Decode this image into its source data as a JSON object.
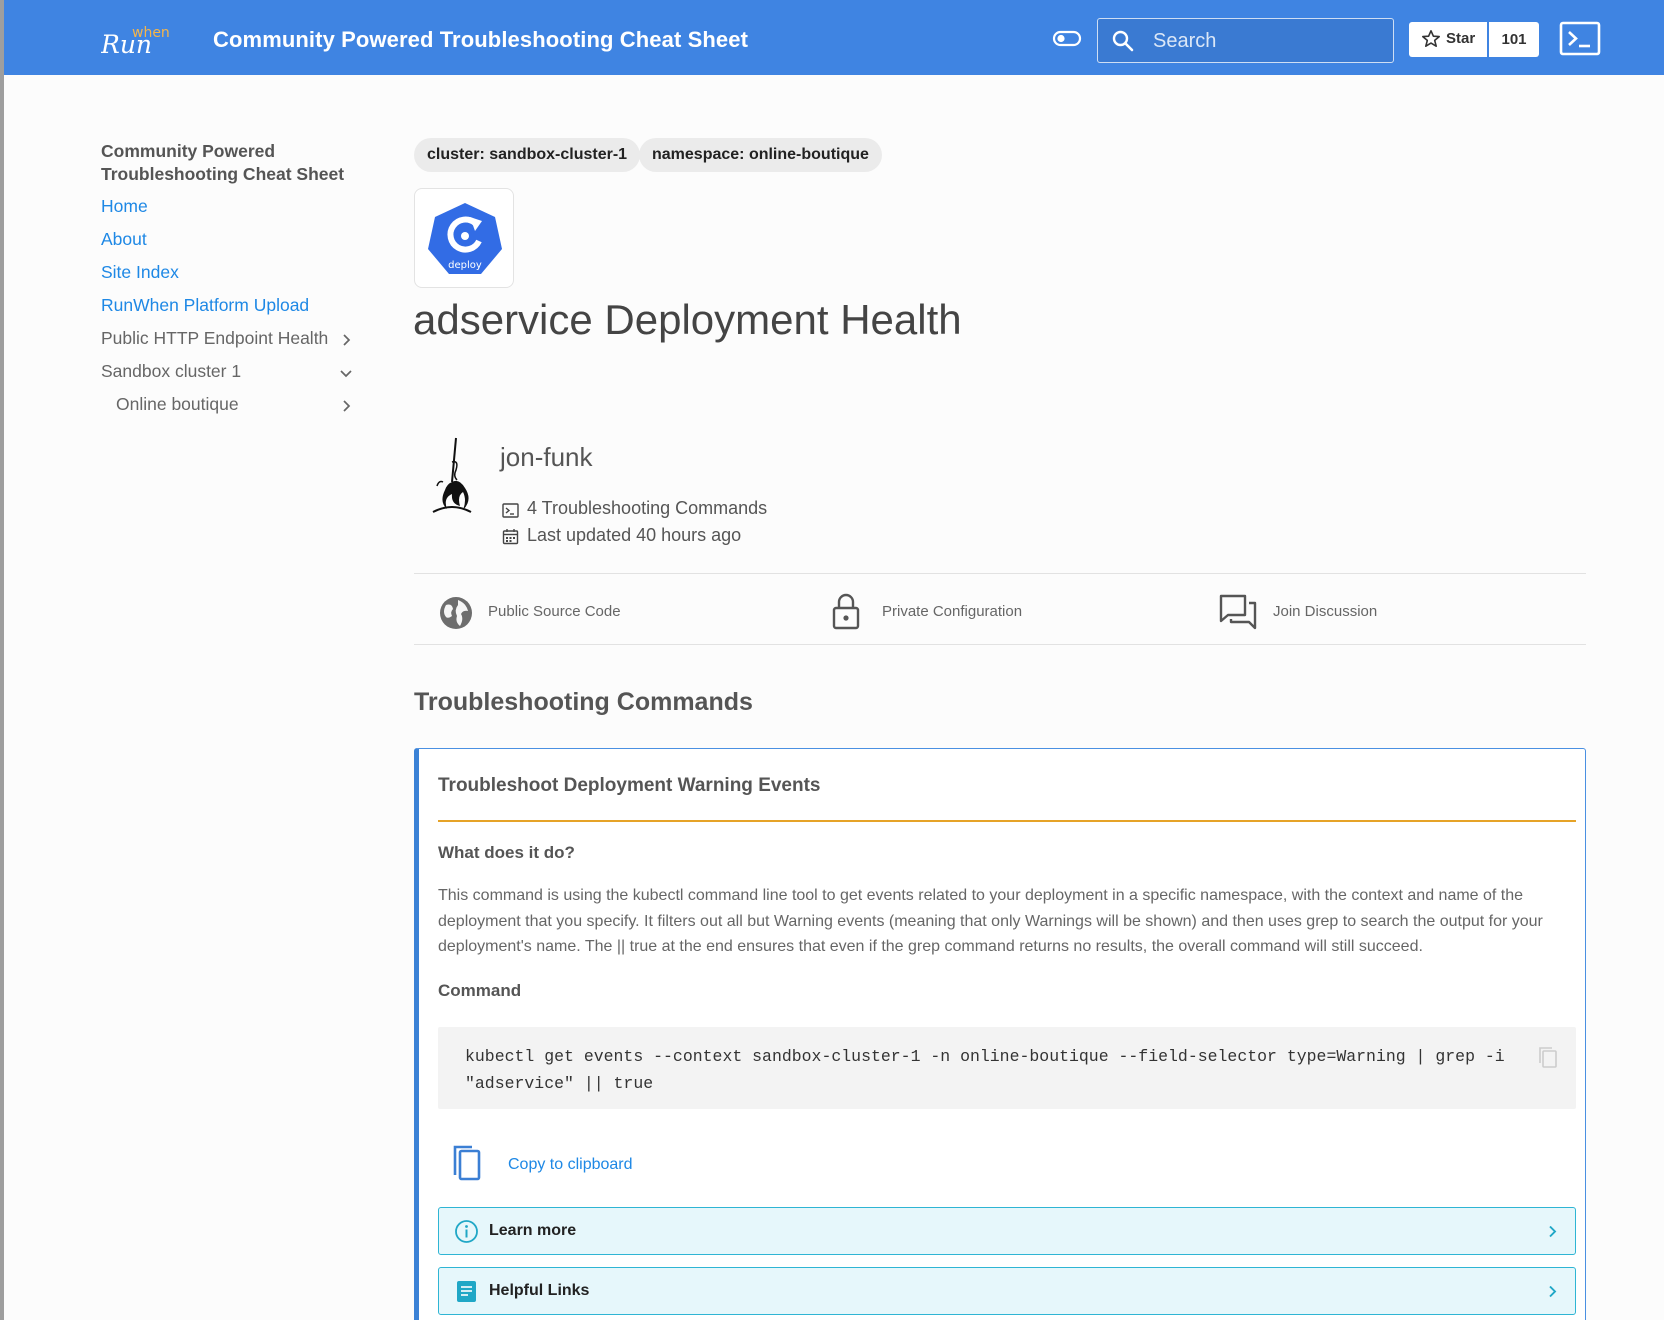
{
  "header": {
    "logo_text": "Run when",
    "title": "Community Powered Troubleshooting Cheat Sheet",
    "search_placeholder": "Search",
    "star_label": "Star",
    "star_count": "101",
    "accent_color": "#3f84e2"
  },
  "sidebar": {
    "title": "Community Powered Troubleshooting Cheat Sheet",
    "items": [
      {
        "label": "Home"
      },
      {
        "label": "About"
      },
      {
        "label": "Site Index"
      },
      {
        "label": "RunWhen Platform Upload"
      },
      {
        "label": "Public HTTP Endpoint Health",
        "icon": "chevron-right-icon"
      },
      {
        "label": "Sandbox cluster 1",
        "icon": "chevron-down-icon"
      },
      {
        "label": "Online boutique",
        "icon": "chevron-right-icon"
      }
    ]
  },
  "main": {
    "tags": [
      "cluster: sandbox-cluster-1",
      "namespace: online-boutique"
    ],
    "icon_label": "deploy",
    "page_title": "adservice Deployment Health",
    "author": "jon-funk",
    "commands_count": "4 Troubleshooting Commands",
    "last_updated": "Last updated 40 hours ago",
    "links": [
      {
        "label": "Public Source Code",
        "icon": "globe-icon"
      },
      {
        "label": "Private Configuration",
        "icon": "lock-icon"
      },
      {
        "label": "Join Discussion",
        "icon": "forum-icon"
      }
    ],
    "section_title": "Troubleshooting Commands",
    "card": {
      "title": "Troubleshoot Deployment Warning Events",
      "what_heading": "What does it do?",
      "description": "This command is using the kubectl command line tool to get events related to your deployment in a specific namespace, with the context and name of the deployment that you specify. It filters out all but Warning events (meaning that only Warnings will be shown) and then uses grep to search the output for your deployment's name. The || true at the end ensures that even if the grep command returns no results, the overall command will still succeed.",
      "command_heading": "Command",
      "command": "kubectl get events --context sandbox-cluster-1 -n online-boutique --field-selector type=Warning | grep -i \"adservice\" || true",
      "copy_label": "Copy to clipboard",
      "learn_more": "Learn more",
      "helpful_links": "Helpful Links"
    }
  }
}
